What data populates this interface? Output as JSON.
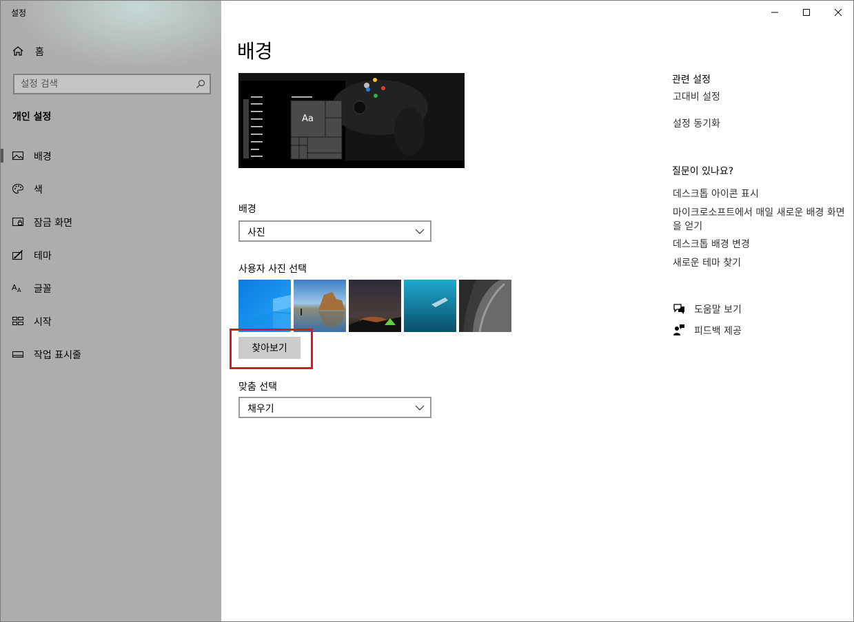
{
  "window": {
    "app_title": "설정",
    "controls": {
      "minimize": "minimize-icon",
      "maximize": "maximize-icon",
      "close": "close-icon"
    }
  },
  "sidebar": {
    "home_label": "홈",
    "search_placeholder": "설정 검색",
    "section_title": "개인 설정",
    "items": [
      {
        "label": "배경",
        "icon": "picture-icon",
        "active": true
      },
      {
        "label": "색",
        "icon": "palette-icon",
        "active": false
      },
      {
        "label": "잠금 화면",
        "icon": "lock-screen-icon",
        "active": false
      },
      {
        "label": "테마",
        "icon": "theme-icon",
        "active": false
      },
      {
        "label": "글꼴",
        "icon": "font-icon",
        "active": false
      },
      {
        "label": "시작",
        "icon": "start-icon",
        "active": false
      },
      {
        "label": "작업 표시줄",
        "icon": "taskbar-icon",
        "active": false
      }
    ]
  },
  "main": {
    "page_title": "배경",
    "preview": {
      "sample_text": "Aa"
    },
    "background_label": "배경",
    "background_value": "사진",
    "choose_picture_label": "사용자 사진 선택",
    "browse_label": "찾아보기",
    "fit_label": "맞춤 선택",
    "fit_value": "채우기"
  },
  "right": {
    "related_title": "관련 설정",
    "related_links": [
      "고대비 설정",
      "설정 동기화"
    ],
    "question_title": "질문이 있나요?",
    "question_links": [
      "데스크톱 아이콘 표시",
      "마이크로소프트에서 매일 새로운 배경 화면을 얻기",
      "데스크톱 배경 변경",
      "새로운 테마 찾기"
    ],
    "help_label": "도움말 보기",
    "feedback_label": "피드백 제공"
  },
  "colors": {
    "sidebar_bg": "#adadad",
    "highlight_red": "#e0161c",
    "button_gray": "#cccccc"
  }
}
